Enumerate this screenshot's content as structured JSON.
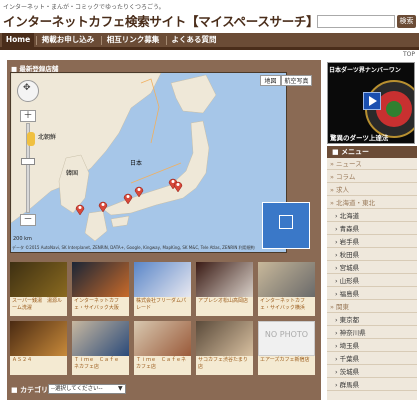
{
  "header": {
    "tagline": "インターネット・まんが・コミックでゆったりくつろごう。",
    "title": "インターネットカフェ検索サイト【マイスペースサーチ】",
    "search_button": "検索"
  },
  "nav": {
    "items": [
      "Home",
      "掲載お申し込み",
      "相互リンク募集",
      "よくある質問"
    ]
  },
  "top_link": "TOP",
  "map_panel": {
    "heading": "最新登録店舗",
    "map_button": "地図",
    "satellite_button": "航空写真",
    "labels": {
      "north_korea": "北朝鮮",
      "south_korea": "韓国",
      "japan": "日本"
    },
    "scale": "200 km",
    "copyright": "データ ©2015 AutoNavi, SK Interplanet, ZENRIN, DATA+, Google, Kingway, MapKing, SK M&C, Tele Atlas, ZENRIN  利用規約"
  },
  "stores": [
    {
      "name": "スーパー銭湯　湯源ルーム洗濯",
      "colors": [
        "#3d2f12",
        "#8a6a20"
      ]
    },
    {
      "name": "インターネットカフェ・サイバック大阪",
      "colors": [
        "#1a2536",
        "#c86a2a"
      ]
    },
    {
      "name": "株式会社フリーダムパレード",
      "colors": [
        "#5a86c8",
        "#e8e8f0"
      ]
    },
    {
      "name": "アプレシオ松山高岡店",
      "colors": [
        "#3a1a14",
        "#d8d0c8"
      ]
    },
    {
      "name": "インターネットカフェ・サイバック横浜",
      "colors": [
        "#c8b89a",
        "#6a6a6a"
      ]
    },
    {
      "name": "ＡＳ２４",
      "colors": [
        "#4a2a12",
        "#c88a3a"
      ]
    },
    {
      "name": "Ｔｉｍｅ　Ｃａｆｅ　ネカフェ店",
      "colors": [
        "#c8b8a0",
        "#2a4a7a"
      ]
    },
    {
      "name": "Ｔｉｍｅ　Ｃａｆｅネカフェ店",
      "colors": [
        "#d8c8b0",
        "#9a5a3a"
      ]
    },
    {
      "name": "サコカフェ渋谷たまり店",
      "colors": [
        "#5a4a3a",
        "#d8c0a0"
      ]
    },
    {
      "name": "エアーズカフェ新宿店",
      "colors": [
        "#e8e8e8",
        "#e8e8e8"
      ]
    }
  ],
  "no_photo": "NO PHOTO",
  "category": {
    "label": "カテゴリ：",
    "select_value": "--選択してください--"
  },
  "banner": {
    "top_text": "日本ダーツ界ナンバーワン",
    "bottom_text": "驚異のダーツ上達法"
  },
  "menu": {
    "heading": "メニュー",
    "items": [
      {
        "label": "ニュース",
        "type": "cat"
      },
      {
        "label": "コラム",
        "type": "cat"
      },
      {
        "label": "求人",
        "type": "cat"
      },
      {
        "label": "北海道・東北",
        "type": "cat"
      },
      {
        "label": "北海道",
        "type": "sub"
      },
      {
        "label": "青森県",
        "type": "sub"
      },
      {
        "label": "岩手県",
        "type": "sub"
      },
      {
        "label": "秋田県",
        "type": "sub"
      },
      {
        "label": "宮城県",
        "type": "sub"
      },
      {
        "label": "山形県",
        "type": "sub"
      },
      {
        "label": "福島県",
        "type": "sub"
      },
      {
        "label": "関東",
        "type": "cat"
      },
      {
        "label": "東京都",
        "type": "sub"
      },
      {
        "label": "神奈川県",
        "type": "sub"
      },
      {
        "label": "埼玉県",
        "type": "sub"
      },
      {
        "label": "千葉県",
        "type": "sub"
      },
      {
        "label": "茨城県",
        "type": "sub"
      },
      {
        "label": "群馬県",
        "type": "sub"
      }
    ]
  },
  "colors": {
    "brown_dark": "#4a2d1a",
    "brown_nav": "#6b4c36",
    "map_water": "#a6c6e8",
    "land": "#efe8d8",
    "pin": "#d8483a"
  }
}
